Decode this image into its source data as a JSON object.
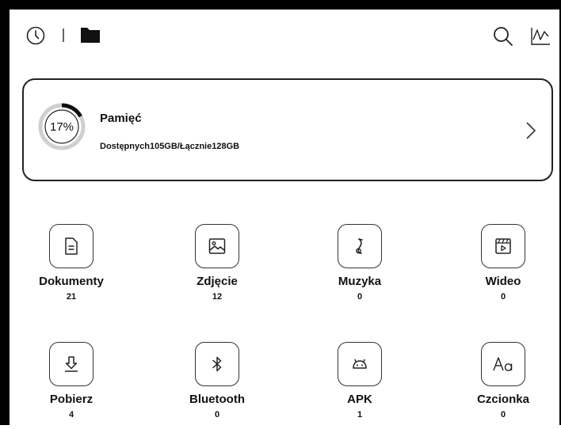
{
  "storage": {
    "title": "Pamięć",
    "percent_label": "17%",
    "used_fraction": 0.17,
    "detail": "Dostępnych105GB/Łącznie128GB"
  },
  "categories": [
    {
      "label": "Dokumenty",
      "count": "21",
      "icon": "document-icon"
    },
    {
      "label": "Zdjęcie",
      "count": "12",
      "icon": "image-icon"
    },
    {
      "label": "Muzyka",
      "count": "0",
      "icon": "music-icon"
    },
    {
      "label": "Wideo",
      "count": "0",
      "icon": "video-icon"
    },
    {
      "label": "Pobierz",
      "count": "4",
      "icon": "download-icon"
    },
    {
      "label": "Bluetooth",
      "count": "0",
      "icon": "bluetooth-icon"
    },
    {
      "label": "APK",
      "count": "1",
      "icon": "android-icon"
    },
    {
      "label": "Czcionka",
      "count": "0",
      "icon": "font-icon"
    }
  ],
  "toolbar_icons": [
    "clock-icon",
    "folder-icon",
    "search-icon",
    "stats-icon"
  ],
  "colors": {
    "foreground": "#111111",
    "background": "#ffffff"
  }
}
